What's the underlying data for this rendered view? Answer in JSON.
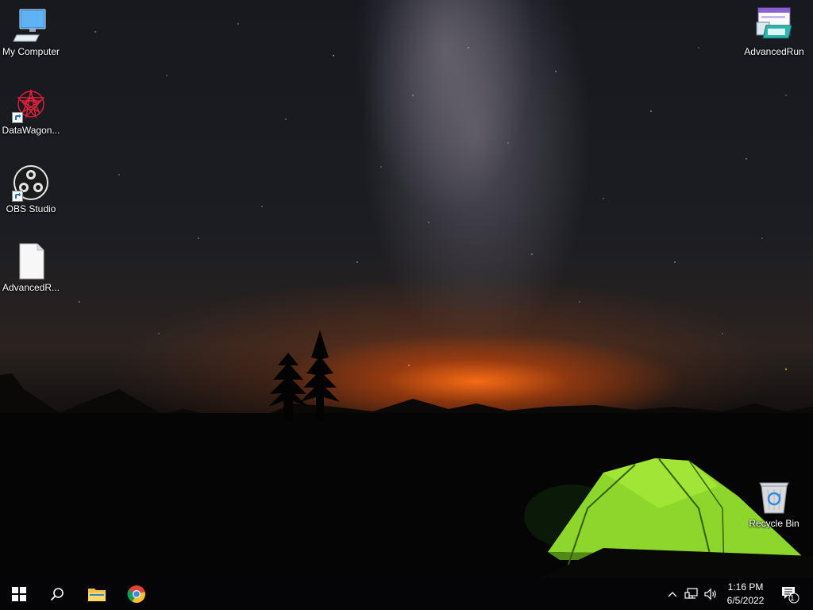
{
  "desktop": {
    "icons": [
      {
        "label": "My Computer",
        "icon": "computer-icon"
      },
      {
        "label": "DataWagon...",
        "icon": "datawagon-icon",
        "shortcut": true
      },
      {
        "label": "OBS Studio",
        "icon": "obs-icon",
        "shortcut": true
      },
      {
        "label": "AdvancedR...",
        "icon": "file-icon"
      },
      {
        "label": "AdvancedRun",
        "icon": "advancedrun-icon"
      },
      {
        "label": "Recycle Bin",
        "icon": "recycle-bin-icon"
      }
    ]
  },
  "taskbar": {
    "buttons": [
      {
        "name": "start",
        "icon": "windows-icon"
      },
      {
        "name": "search",
        "icon": "search-icon"
      },
      {
        "name": "file-explorer",
        "icon": "folder-icon"
      },
      {
        "name": "chrome",
        "icon": "chrome-icon"
      }
    ],
    "tray": {
      "icons": [
        "chevron-up-icon",
        "network-icon",
        "volume-icon"
      ],
      "time": "1:16 PM",
      "date": "6/5/2022",
      "notification_count": "1"
    }
  }
}
